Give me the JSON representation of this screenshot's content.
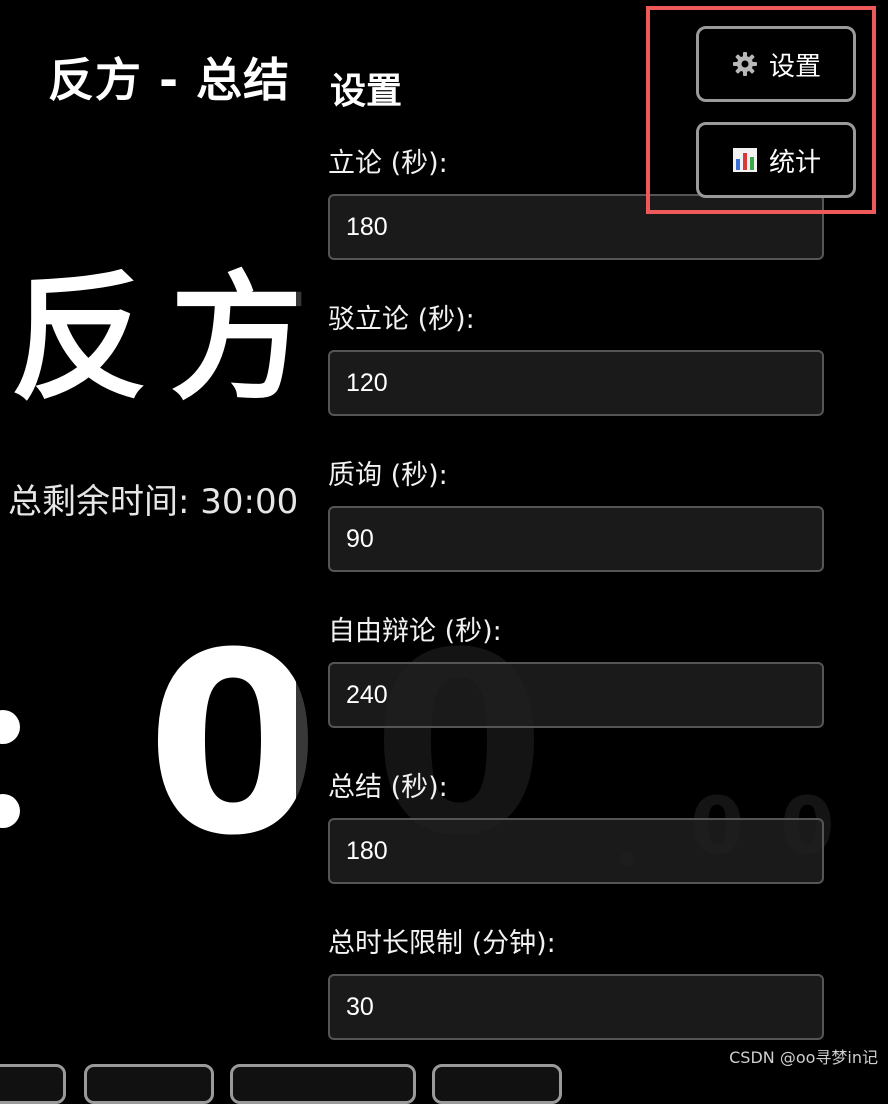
{
  "header": {
    "stage_title": "反方 - 总结"
  },
  "speaker": {
    "name": "反方"
  },
  "total_remaining": {
    "text": "总剩余时间: 30:00"
  },
  "timer": {
    "digit_1": "0",
    "digit_2": "0",
    "ms": "00"
  },
  "settings": {
    "title": "设置",
    "fields": [
      {
        "label": "立论 (秒):",
        "value": "180"
      },
      {
        "label": "驳立论 (秒):",
        "value": "120"
      },
      {
        "label": "质询 (秒):",
        "value": "90"
      },
      {
        "label": "自由辩论 (秒):",
        "value": "240"
      },
      {
        "label": "总结 (秒):",
        "value": "180"
      },
      {
        "label": "总时长限制 (分钟):",
        "value": "30"
      }
    ]
  },
  "buttons": {
    "settings_label": "设置",
    "settings_icon": "gear-icon",
    "stats_label": "统计",
    "stats_icon": "bar-chart-icon"
  },
  "colors": {
    "highlight": "#ee5a5a",
    "dim_digit": "#5a5a5a"
  },
  "watermark": {
    "text": "CSDN @oo寻梦in记"
  }
}
